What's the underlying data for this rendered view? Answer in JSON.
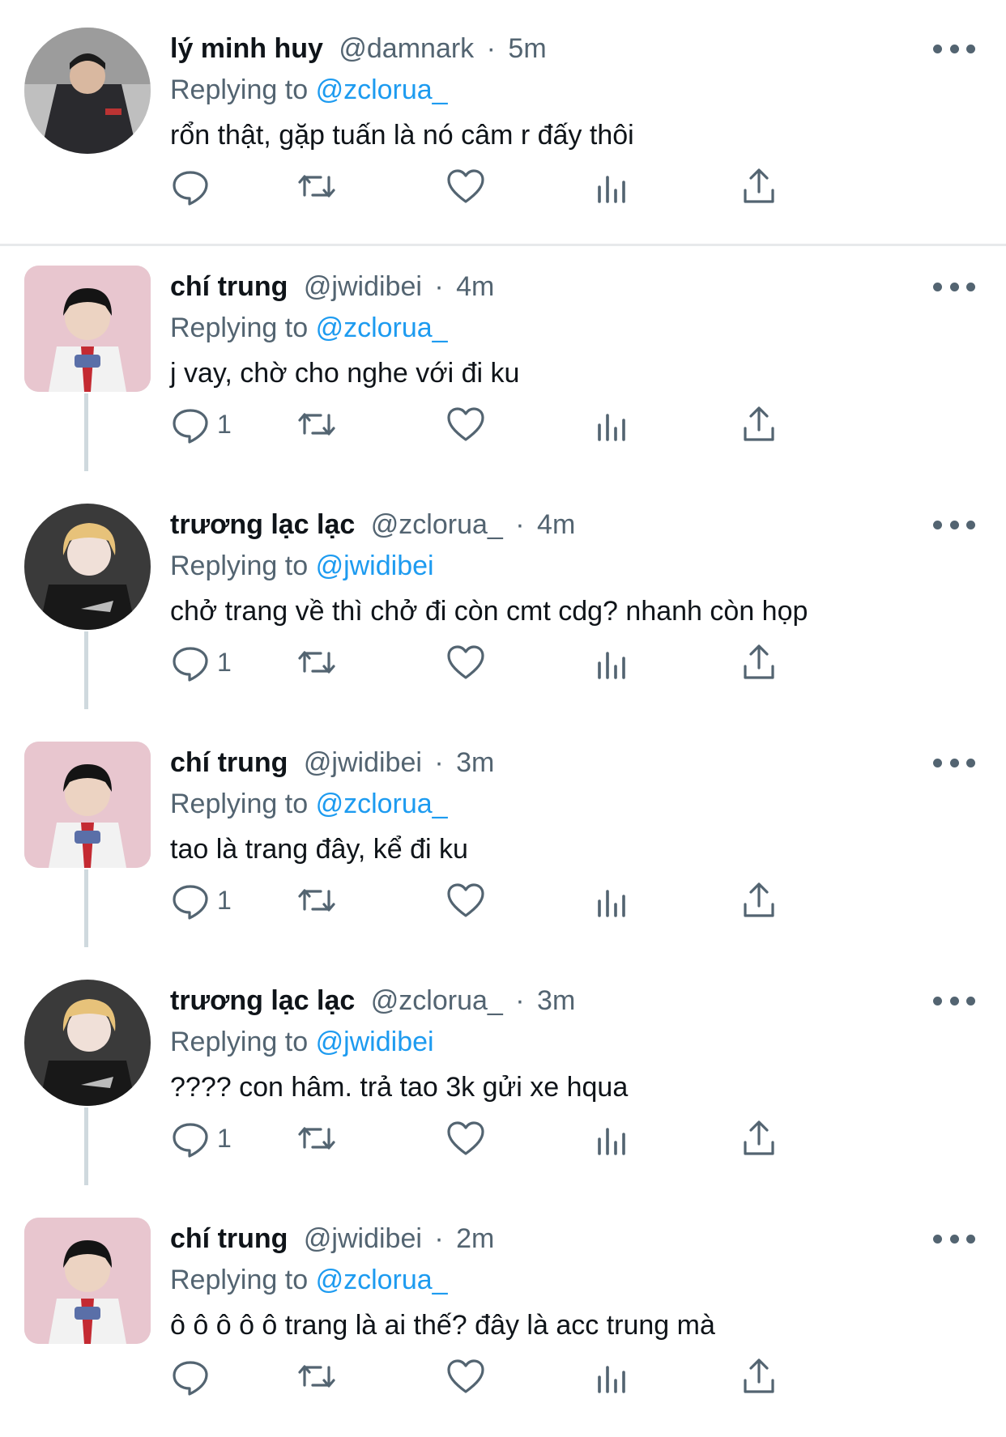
{
  "labels": {
    "replying_to": "Replying to"
  },
  "colors": {
    "accent": "#1d9bf0",
    "muted": "#536471",
    "text": "#0f1419",
    "thread": "#cfd9de"
  },
  "tweets": [
    {
      "name": "lý minh huy",
      "handle": "@damnark",
      "sep": "·",
      "time": "5m",
      "reply_to": "@zclorua_",
      "text": "rổn thật, gặp tuấn là nó câm r đấy thôi",
      "reply_count": "",
      "avatar": "dark-jacket-photo"
    },
    {
      "name": "chí trung",
      "handle": "@jwidibei",
      "sep": "·",
      "time": "4m",
      "reply_to": "@zclorua_",
      "text": "j vay, chờ cho nghe với đi ku",
      "reply_count": "1",
      "avatar": "red-tie-photo"
    },
    {
      "name": "trương lạc lạc",
      "handle": "@zclorua_",
      "sep": "·",
      "time": "4m",
      "reply_to": "@jwidibei",
      "text": "chở trang về thì chở đi còn cmt cdg? nhanh còn họp",
      "reply_count": "1",
      "avatar": "blonde-hoodie-photo"
    },
    {
      "name": "chí trung",
      "handle": "@jwidibei",
      "sep": "·",
      "time": "3m",
      "reply_to": "@zclorua_",
      "text": "tao là trang đây, kể đi ku",
      "reply_count": "1",
      "avatar": "red-tie-photo"
    },
    {
      "name": "trương lạc lạc",
      "handle": "@zclorua_",
      "sep": "·",
      "time": "3m",
      "reply_to": "@jwidibei",
      "text": "???? con hâm. trả tao 3k gửi xe hqua",
      "reply_count": "1",
      "avatar": "blonde-hoodie-photo"
    },
    {
      "name": "chí trung",
      "handle": "@jwidibei",
      "sep": "·",
      "time": "2m",
      "reply_to": "@zclorua_",
      "text": "ô ô ô ô ô trang là ai thế? đây là acc trung mà",
      "reply_count": "",
      "avatar": "red-tie-photo"
    }
  ],
  "icons": [
    "reply-icon",
    "retweet-icon",
    "like-icon",
    "views-icon",
    "share-icon",
    "more-icon"
  ]
}
